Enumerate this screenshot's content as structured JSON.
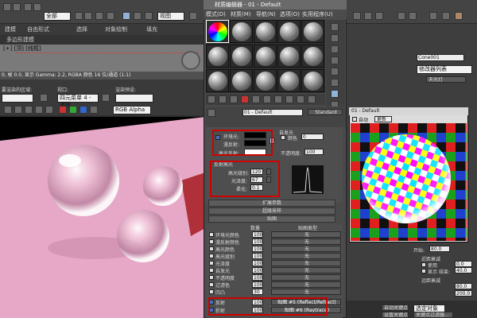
{
  "toolbar": {
    "all_combo": "全部",
    "view_combo": "视图"
  },
  "ribbon_tabs": [
    "建模",
    "自由形式",
    "选择",
    "对象绘制",
    "填充"
  ],
  "subtitle": "多边形建模",
  "viewport_top": {
    "label": "[+] [顶] [线框]"
  },
  "render_frame": {
    "title": "0, 帧 0.0, 显示 Gamma: 2.2, RGBA 颜色 16 位/通道 (1:1)",
    "area_label": "要渲染的区域:",
    "viewport_label": "视口:",
    "viewport_value": "四元菜单 4 - 透视",
    "preset_label": "渲染预设:",
    "channel_value": "RGB Alpha"
  },
  "material_editor": {
    "title": "材质编辑器 - 01 - Default",
    "menu": [
      "模式(D)",
      "材质(M)",
      "导航(N)",
      "选项(O)",
      "实用程序(U)"
    ],
    "material_name": "01 - Default",
    "shader_type": "Standard",
    "ambient_label": "环境光:",
    "diffuse_label": "漫反射:",
    "specular_label": "高光反射:",
    "self_illum_label": "自发光",
    "color_label": "颜色",
    "self_illum_value": "0",
    "opacity_label": "不透明度:",
    "opacity_value": "100",
    "specular_section": "反射高光",
    "spec_level_label": "高光级别:",
    "spec_level_value": "120",
    "glossiness_label": "光泽度:",
    "glossiness_value": "67",
    "soften_label": "柔化:",
    "soften_value": "0.1",
    "rollout_extended": "扩展参数",
    "rollout_supersampling": "超级采样",
    "rollout_maps": "贴图",
    "maps_amount_header": "数量",
    "maps_type_header": "贴图类型",
    "maps": [
      {
        "name": "环境光颜色",
        "amount": "100",
        "map": "无",
        "checked": false
      },
      {
        "name": "漫反射颜色",
        "amount": "100",
        "map": "无",
        "checked": false
      },
      {
        "name": "高光颜色",
        "amount": "100",
        "map": "无",
        "checked": false
      },
      {
        "name": "高光级别",
        "amount": "100",
        "map": "无",
        "checked": false
      },
      {
        "name": "光泽度",
        "amount": "100",
        "map": "无",
        "checked": false
      },
      {
        "name": "自发光",
        "amount": "100",
        "map": "无",
        "checked": false
      },
      {
        "name": "不透明度",
        "amount": "100",
        "map": "无",
        "checked": false
      },
      {
        "name": "过滤色",
        "amount": "100",
        "map": "无",
        "checked": false
      },
      {
        "name": "凹凸",
        "amount": "30",
        "map": "无",
        "checked": false
      },
      {
        "name": "反射",
        "amount": "100",
        "map": "贴图 #5 (Reflect/Refract)",
        "checked": true
      },
      {
        "name": "折射",
        "amount": "100",
        "map": "贴图 #6 (Raytrace)",
        "checked": true
      }
    ]
  },
  "right_panel": {
    "object_name": "Cone001",
    "modifier_list": "修改器列表",
    "spot_label": "天光灯",
    "start_label": "开始:",
    "start_value": "80.0",
    "attenuation_near": "近距衰减",
    "attenuation_far": "远距衰减",
    "use_label": "使用",
    "show_label": "显示",
    "end_label": "结束:",
    "end_value": "40.0",
    "near_start": "0.0",
    "far_start": "80.0",
    "far_end": "200.0",
    "auto_key": "自动关键点",
    "selected_object": "选定对象",
    "set_key": "设置关键点",
    "key_filter": "关键点过滤器..."
  },
  "preview_window": {
    "title": "01 - Default",
    "auto_label": "自动",
    "update_label": "更新"
  },
  "colors": {
    "red_highlight": "#d00000",
    "scene_pink": "#e6a8c6",
    "scene_red": "#b0303a"
  }
}
